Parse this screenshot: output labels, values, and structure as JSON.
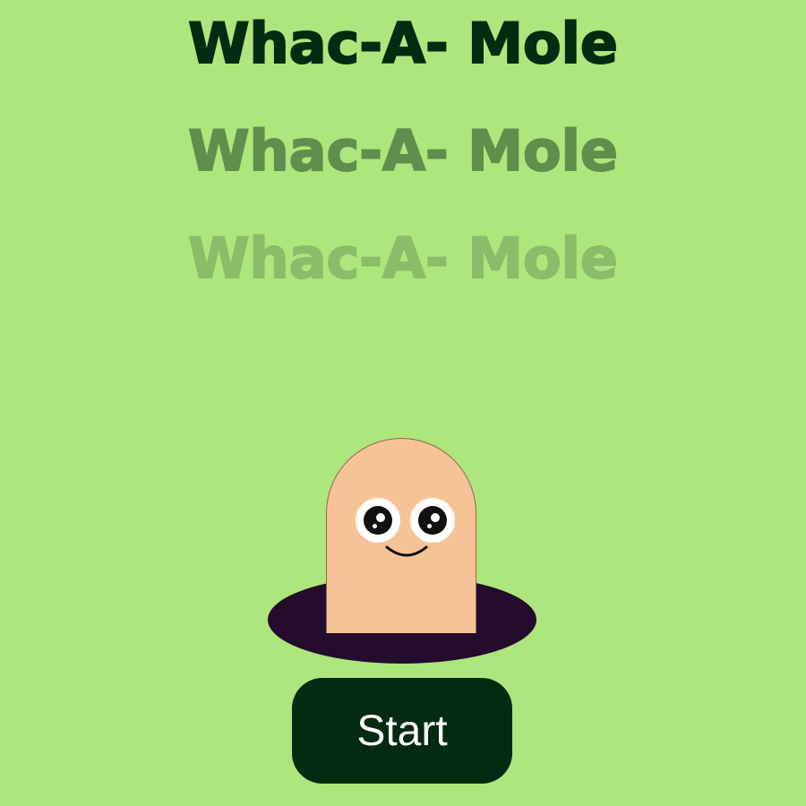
{
  "titles": {
    "line1": "Whac-A- Mole",
    "line2": "Whac-A- Mole",
    "line3": "Whac-A- Mole"
  },
  "start_button": {
    "label": "Start"
  },
  "colors": {
    "background": "#ade67c",
    "title_primary": "#022b12",
    "title_secondary": "#5e8f4c",
    "title_tertiary": "#8abd69",
    "mole_skin": "#f5c396",
    "hole": "#250b2d",
    "button": "#022b12"
  }
}
